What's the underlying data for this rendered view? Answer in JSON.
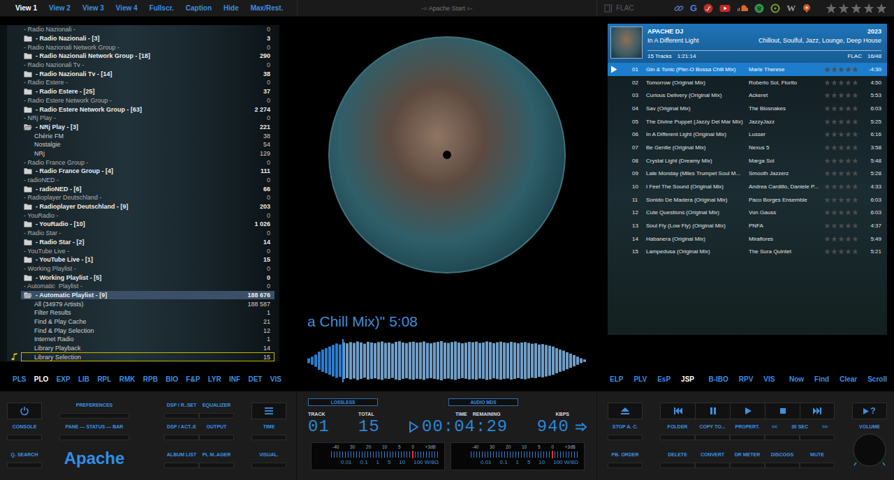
{
  "top_bar": {
    "view_tabs": [
      {
        "label": "View 1",
        "selected": true
      },
      {
        "label": "View 2",
        "selected": false
      },
      {
        "label": "View 3",
        "selected": false
      },
      {
        "label": "View 4",
        "selected": false
      },
      {
        "label": "Fullscr.",
        "selected": false
      },
      {
        "label": "Caption",
        "selected": false
      },
      {
        "label": "Hide",
        "selected": false
      },
      {
        "label": "Max/Rest.",
        "selected": false
      }
    ],
    "title": "-= Apache Start =-",
    "format": "FLAC",
    "link_letters": {
      "google": "G",
      "wikipedia": "W"
    },
    "rating": {
      "stars": 0
    }
  },
  "library_tree": {
    "rows": [
      {
        "label": "- Radio Nazionali -",
        "count": "0",
        "kind": "header",
        "expanded": false,
        "selected": false,
        "focused": false,
        "playing": false
      },
      {
        "label": "- Radio Nazionali - [3]",
        "count": "3",
        "kind": "group",
        "expanded": false,
        "selected": false,
        "focused": false,
        "playing": false
      },
      {
        "label": "- Radio Nazionali Network Group -",
        "count": "0",
        "kind": "header",
        "expanded": false,
        "selected": false,
        "focused": false,
        "playing": false
      },
      {
        "label": "- Radio Nazionali Network Group - [18]",
        "count": "290",
        "kind": "group",
        "expanded": false,
        "selected": false,
        "focused": false,
        "playing": false
      },
      {
        "label": "- Radio Nazionali Tv -",
        "count": "0",
        "kind": "header",
        "expanded": false,
        "selected": false,
        "focused": false,
        "playing": false
      },
      {
        "label": "- Radio Nazionali Tv - [14]",
        "count": "38",
        "kind": "group",
        "expanded": false,
        "selected": false,
        "focused": false,
        "playing": false
      },
      {
        "label": "- Radio Estere -",
        "count": "0",
        "kind": "header",
        "expanded": false,
        "selected": false,
        "focused": false,
        "playing": false
      },
      {
        "label": "- Radio Estere - [25]",
        "count": "37",
        "kind": "group",
        "expanded": false,
        "selected": false,
        "focused": false,
        "playing": false
      },
      {
        "label": "- Radio Estere Network Group -",
        "count": "0",
        "kind": "header",
        "expanded": false,
        "selected": false,
        "focused": false,
        "playing": false
      },
      {
        "label": "- Radio Estere Network Group - [63]",
        "count": "2 274",
        "kind": "group",
        "expanded": false,
        "selected": false,
        "focused": false,
        "playing": false
      },
      {
        "label": "- NRj Play -",
        "count": "0",
        "kind": "header",
        "expanded": false,
        "selected": false,
        "focused": false,
        "playing": false
      },
      {
        "label": "- NRj Play - [3]",
        "count": "221",
        "kind": "group",
        "expanded": true,
        "selected": false,
        "focused": false,
        "playing": false
      },
      {
        "label": "Chérie FM",
        "count": "38",
        "kind": "child",
        "expanded": false,
        "selected": false,
        "focused": false,
        "playing": false
      },
      {
        "label": "Nostalgie",
        "count": "54",
        "kind": "child",
        "expanded": false,
        "selected": false,
        "focused": false,
        "playing": false
      },
      {
        "label": "NRj",
        "count": "129",
        "kind": "child",
        "expanded": false,
        "selected": false,
        "focused": false,
        "playing": false
      },
      {
        "label": "- Radio France Group -",
        "count": "0",
        "kind": "header",
        "expanded": false,
        "selected": false,
        "focused": false,
        "playing": false
      },
      {
        "label": "- Radio France Group - [4]",
        "count": "111",
        "kind": "group",
        "expanded": false,
        "selected": false,
        "focused": false,
        "playing": false
      },
      {
        "label": "- radioNED -",
        "count": "0",
        "kind": "header",
        "expanded": false,
        "selected": false,
        "focused": false,
        "playing": false
      },
      {
        "label": "- radioNED - [6]",
        "count": "66",
        "kind": "group",
        "expanded": false,
        "selected": false,
        "focused": false,
        "playing": false
      },
      {
        "label": "- Radioplayer Deutschland -",
        "count": "0",
        "kind": "header",
        "expanded": false,
        "selected": false,
        "focused": false,
        "playing": false
      },
      {
        "label": "- Radioplayer Deutschland - [9]",
        "count": "203",
        "kind": "group",
        "expanded": false,
        "selected": false,
        "focused": false,
        "playing": false
      },
      {
        "label": "- YouRadio -",
        "count": "0",
        "kind": "header",
        "expanded": false,
        "selected": false,
        "focused": false,
        "playing": false
      },
      {
        "label": "- YouRadio - [10]",
        "count": "1 026",
        "kind": "group",
        "expanded": false,
        "selected": false,
        "focused": false,
        "playing": false
      },
      {
        "label": "- Radio Star -",
        "count": "0",
        "kind": "header",
        "expanded": false,
        "selected": false,
        "focused": false,
        "playing": false
      },
      {
        "label": "- Radio Star - [2]",
        "count": "14",
        "kind": "group",
        "expanded": false,
        "selected": false,
        "focused": false,
        "playing": false
      },
      {
        "label": "- YouTube Live -",
        "count": "0",
        "kind": "header",
        "expanded": false,
        "selected": false,
        "focused": false,
        "playing": false
      },
      {
        "label": "- YouTube Live - [1]",
        "count": "15",
        "kind": "group",
        "expanded": false,
        "selected": false,
        "focused": false,
        "playing": false
      },
      {
        "label": "- Working Playlist -",
        "count": "0",
        "kind": "header",
        "expanded": false,
        "selected": false,
        "focused": false,
        "playing": false
      },
      {
        "label": "- Working Playlist - [5]",
        "count": "0",
        "kind": "group",
        "expanded": false,
        "selected": false,
        "focused": false,
        "playing": false
      },
      {
        "label": "- Automatic  Playlist -",
        "count": "0",
        "kind": "header",
        "expanded": false,
        "selected": false,
        "focused": false,
        "playing": false
      },
      {
        "label": "- Automatic Playlist - [9]",
        "count": "188 676",
        "kind": "group",
        "expanded": true,
        "selected": true,
        "focused": false,
        "playing": false
      },
      {
        "label": "All (34979 Artists)",
        "count": "188 587",
        "kind": "child",
        "expanded": false,
        "selected": false,
        "focused": false,
        "playing": false
      },
      {
        "label": "Filter Results",
        "count": "1",
        "kind": "child",
        "expanded": false,
        "selected": false,
        "focused": false,
        "playing": false
      },
      {
        "label": "Find & Play Cache",
        "count": "21",
        "kind": "child",
        "expanded": false,
        "selected": false,
        "focused": false,
        "playing": false
      },
      {
        "label": "Find & Play Selection",
        "count": "12",
        "kind": "child",
        "expanded": false,
        "selected": false,
        "focused": false,
        "playing": false
      },
      {
        "label": "Internet Radio",
        "count": "1",
        "kind": "child",
        "expanded": false,
        "selected": false,
        "focused": false,
        "playing": false
      },
      {
        "label": "Library Playback",
        "count": "14",
        "kind": "child",
        "expanded": false,
        "selected": false,
        "focused": false,
        "playing": false
      },
      {
        "label": "Library Selection",
        "count": "15",
        "kind": "child",
        "expanded": false,
        "selected": false,
        "focused": true,
        "playing": true
      }
    ]
  },
  "left_tabs": [
    {
      "label": "PLS",
      "selected": false
    },
    {
      "label": "PLO",
      "selected": true
    },
    {
      "label": "EXP",
      "selected": false
    },
    {
      "label": "LIB",
      "selected": false
    },
    {
      "label": "RPL",
      "selected": false
    },
    {
      "label": "RMK",
      "selected": false
    },
    {
      "label": "RPB",
      "selected": false
    },
    {
      "label": "BIO",
      "selected": false
    },
    {
      "label": "F&P",
      "selected": false
    },
    {
      "label": "LYR",
      "selected": false
    },
    {
      "label": "INF",
      "selected": false
    },
    {
      "label": "DET",
      "selected": false
    },
    {
      "label": "VIS",
      "selected": false
    }
  ],
  "now_playing": {
    "scroll_text": "a Chill Mix)\" 5:08"
  },
  "waveform": {
    "level": 0.125,
    "peaks": [
      0.12,
      0.2,
      0.3,
      0.45,
      0.55,
      0.62,
      0.7,
      0.78,
      0.85,
      0.8,
      0.9,
      0.86,
      0.92,
      0.88,
      0.95,
      0.9,
      0.84,
      0.93,
      0.9,
      0.87,
      0.92,
      0.95,
      0.88,
      0.9,
      0.85,
      0.93,
      0.96,
      0.9,
      0.87,
      0.92,
      0.94,
      0.89,
      0.91,
      0.95,
      0.88,
      0.86,
      0.9,
      0.93,
      0.97,
      0.9,
      0.88,
      0.92,
      0.95,
      0.9,
      0.86,
      0.89,
      0.93,
      0.91,
      0.94,
      0.88,
      0.9,
      0.95,
      0.92,
      0.87,
      0.91,
      0.94,
      0.9,
      0.88,
      0.93,
      0.9,
      0.86,
      0.9,
      0.92,
      0.88,
      0.84,
      0.86,
      0.8,
      0.82,
      0.78,
      0.74,
      0.7,
      0.62,
      0.55,
      0.5,
      0.42,
      0.35,
      0.28,
      0.2,
      0.12,
      0.06
    ]
  },
  "playlist": {
    "artist": "APACHE DJ",
    "year": "2023",
    "album": "In A Different Light",
    "genres": "Chillout, Soulful, Jazz, Lounge, Deep House",
    "track_count": "15 Tracks",
    "length": "1:21:14",
    "codec": "FLAC",
    "bits": "16/48",
    "rows": [
      {
        "number": "01",
        "title": "Gin & Tonic (Pier-O Bossa Chill Mix)",
        "artist": "Marie Therese",
        "stars": 0,
        "duration": "-4:30",
        "selected": true,
        "playing": true
      },
      {
        "number": "02",
        "title": "Tomorrow (Original Mix)",
        "artist": "Roberto Sol, Florito",
        "stars": 0,
        "duration": "4:50",
        "selected": false,
        "playing": false
      },
      {
        "number": "03",
        "title": "Curious Delivery (Original Mix)",
        "artist": "Ackeret",
        "stars": 0,
        "duration": "5:53",
        "selected": false,
        "playing": false
      },
      {
        "number": "04",
        "title": "Sav (Original Mix)",
        "artist": "The Biosnakes",
        "stars": 0,
        "duration": "6:03",
        "selected": false,
        "playing": false
      },
      {
        "number": "05",
        "title": "The Divine Puppet (Jazzy Del Mar Mix)",
        "artist": "JazzyJazz",
        "stars": 0,
        "duration": "5:25",
        "selected": false,
        "playing": false
      },
      {
        "number": "06",
        "title": "In A Different Light (Original Mix)",
        "artist": "Lusser",
        "stars": 0,
        "duration": "6:16",
        "selected": false,
        "playing": false
      },
      {
        "number": "07",
        "title": "Be Gentle (Original Mix)",
        "artist": "Nexus 5",
        "stars": 0,
        "duration": "3:58",
        "selected": false,
        "playing": false
      },
      {
        "number": "08",
        "title": "Crystal Light (Dreamy Mix)",
        "artist": "Marga Sol",
        "stars": 0,
        "duration": "5:48",
        "selected": false,
        "playing": false
      },
      {
        "number": "09",
        "title": "Late Monday (Miles Trumpet Soul M...",
        "artist": "Smooth Jazzerz",
        "stars": 0,
        "duration": "5:28",
        "selected": false,
        "playing": false
      },
      {
        "number": "10",
        "title": "I Feel The Sound (Original Mix)",
        "artist": "Andrea Cardillo, Daniele P...",
        "stars": 0,
        "duration": "4:33",
        "selected": false,
        "playing": false
      },
      {
        "number": "11",
        "title": "Sonido De Madera (Original Mix)",
        "artist": "Paco Borges Ensemble",
        "stars": 0,
        "duration": "6:03",
        "selected": false,
        "playing": false
      },
      {
        "number": "12",
        "title": "Cute Questions (Original Mix)",
        "artist": "Von Gauss",
        "stars": 0,
        "duration": "6:03",
        "selected": false,
        "playing": false
      },
      {
        "number": "13",
        "title": "Soul Fly (Low Fly) (Original Mix)",
        "artist": "PNFA",
        "stars": 0,
        "duration": "4:37",
        "selected": false,
        "playing": false
      },
      {
        "number": "14",
        "title": "Habanera (Original Mix)",
        "artist": "Miraflores",
        "stars": 0,
        "duration": "5:49",
        "selected": false,
        "playing": false
      },
      {
        "number": "15",
        "title": "Lampedusa (Original Mix)",
        "artist": "The Sura Quintet",
        "stars": 0,
        "duration": "5:21",
        "selected": false,
        "playing": false
      }
    ]
  },
  "right_tabs": [
    [
      {
        "label": "ELP",
        "selected": false
      },
      {
        "label": "PLV",
        "selected": false
      },
      {
        "label": "EsP",
        "selected": false
      },
      {
        "label": "JSP",
        "selected": true
      }
    ],
    [
      {
        "label": "B-IBO",
        "selected": false
      },
      {
        "label": "RPV",
        "selected": false
      },
      {
        "label": "VIS",
        "selected": false
      }
    ],
    [
      {
        "label": "Now",
        "selected": false
      },
      {
        "label": "Find",
        "selected": false
      },
      {
        "label": "Clear",
        "selected": false
      },
      {
        "label": "Scroll",
        "selected": false
      }
    ]
  ],
  "controls": {
    "left": {
      "preferences": "PREFERENCES",
      "dsp_reset": "DSP / R..SET",
      "equalizer": "EQUALIZER",
      "console": "CONSOLE",
      "pane_status_bar": "PANE — STATUS — BAR",
      "dsp_active": "DSP / ACT..E",
      "output": "OUTPUT",
      "time": "TIME",
      "quick_search": "Q. SEARCH",
      "logo": "Apache",
      "album_list": "ALBUM LIST",
      "playlist_manager": "PL M..AGER",
      "visual": "VISUAL."
    },
    "right": {
      "stop_after_current": "STOP A. C.",
      "playback_order": "PB. ORDER",
      "folder": "FOLDER",
      "copy_to": "COPY TO...",
      "properties": "PROPERT.",
      "seek_back": "<<",
      "seek_amount": "30 SEC",
      "seek_forward": ">>",
      "delete": "DELETE",
      "convert": "CONVERT",
      "dr_meter": "DR METER",
      "discogs": "DISCOGS",
      "mute": "MUTE",
      "help": "?",
      "volume": "VOLUME"
    }
  },
  "display": {
    "badges": [
      "LOSSLESS",
      "AUDIO MDS"
    ],
    "track_label": "TRACK",
    "track": "01",
    "total_label": "TOTAL",
    "total": "15",
    "time_label": "TIME",
    "remaining_label": "REMAINING",
    "time": "00:04:29",
    "kbps_label": "KBPS",
    "kbps": "940"
  },
  "meters": [
    {
      "top_scale": [
        "-40",
        "30",
        "20",
        "10",
        "5",
        "0",
        "+3dB"
      ],
      "bottom_scale": [
        "0.01",
        "0.1",
        "1",
        "5",
        "10",
        "100 W/8Ω"
      ],
      "level": 0.75
    },
    {
      "top_scale": [
        "-40",
        "30",
        "20",
        "10",
        "5",
        "0",
        "+3dB"
      ],
      "bottom_scale": [
        "0.01",
        "0.1",
        "1",
        "5",
        "10",
        "100 W/8Ω"
      ],
      "level": 0.75
    }
  ]
}
